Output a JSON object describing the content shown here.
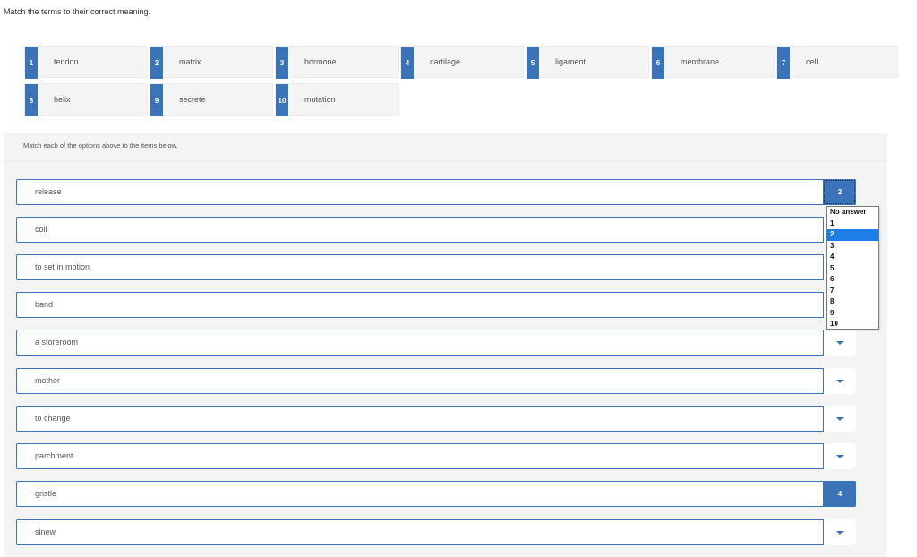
{
  "question": "Match the terms to their correct meaning.",
  "terms": [
    {
      "num": "1",
      "label": "tendon"
    },
    {
      "num": "2",
      "label": "matrix"
    },
    {
      "num": "3",
      "label": "hormone"
    },
    {
      "num": "4",
      "label": "cartilage"
    },
    {
      "num": "5",
      "label": "ligament"
    },
    {
      "num": "6",
      "label": "membrane"
    },
    {
      "num": "7",
      "label": "cell"
    },
    {
      "num": "8",
      "label": "helix"
    },
    {
      "num": "9",
      "label": "secrete"
    },
    {
      "num": "10",
      "label": "mutation"
    }
  ],
  "instruction": "Match each of the options above to the items below.",
  "items": [
    {
      "label": "release",
      "answer": "2"
    },
    {
      "label": "coil",
      "answer": ""
    },
    {
      "label": "to set in motion",
      "answer": ""
    },
    {
      "label": "band",
      "answer": ""
    },
    {
      "label": "a storeroom",
      "answer": ""
    },
    {
      "label": "mother",
      "answer": ""
    },
    {
      "label": "to change",
      "answer": ""
    },
    {
      "label": "parchment",
      "answer": ""
    },
    {
      "label": "gristle",
      "answer": "4"
    },
    {
      "label": "sinew",
      "answer": ""
    }
  ],
  "dropdown": {
    "options": [
      "No answer",
      "1",
      "2",
      "3",
      "4",
      "5",
      "6",
      "7",
      "8",
      "9",
      "10"
    ],
    "highlighted": "2"
  },
  "colors": {
    "accent": "#3a73b8",
    "highlight": "#1e7ee6"
  }
}
